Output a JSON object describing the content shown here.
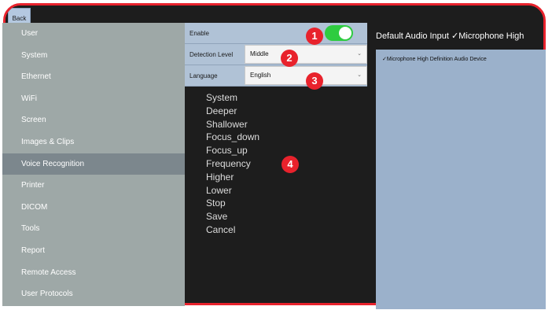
{
  "topbar": {
    "back_label": "Back"
  },
  "sidebar": {
    "items": [
      {
        "label": "User"
      },
      {
        "label": "System"
      },
      {
        "label": "Ethernet"
      },
      {
        "label": "WiFi"
      },
      {
        "label": "Screen"
      },
      {
        "label": "Images & Clips"
      },
      {
        "label": "Voice Recognition",
        "active": true
      },
      {
        "label": "Printer"
      },
      {
        "label": "DICOM"
      },
      {
        "label": "Tools"
      },
      {
        "label": "Report"
      },
      {
        "label": "Remote Access"
      },
      {
        "label": "User Protocols"
      }
    ]
  },
  "settings": {
    "enable": {
      "label": "Enable",
      "value": true
    },
    "detection_level": {
      "label": "Detection Level",
      "value": "Middle"
    },
    "language": {
      "label": "Language",
      "value": "English"
    }
  },
  "commands": [
    "System",
    "Deeper",
    "Shallower",
    "Focus_down",
    "Focus_up",
    "Frequency",
    "Higher",
    "Lower",
    "Stop",
    "Save",
    "Cancel"
  ],
  "markers": [
    "1",
    "2",
    "3",
    "4"
  ],
  "audio": {
    "title": "Default Audio Input  ✓Microphone High",
    "device": "✓Microphone High Definition Audio Device"
  },
  "colors": {
    "accent": "#e8222c",
    "toggle_on": "#2ecc40",
    "panel": "#9bb1cb",
    "sidebar": "#9ea8a7"
  }
}
